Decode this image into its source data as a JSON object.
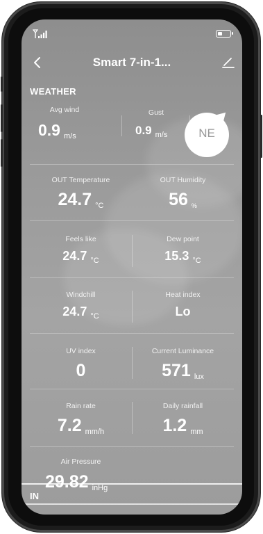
{
  "app": {
    "title": "Smart 7-in-1...",
    "section_weather": "WEATHER",
    "section_in": "IN"
  },
  "wind": {
    "avg_label": "Avg wind",
    "avg_value": "0.9",
    "avg_unit": "m/s",
    "gust_label": "Gust",
    "gust_value": "0.9",
    "gust_unit": "m/s",
    "direction": "NE"
  },
  "cells": {
    "out_temp_label": "OUT Temperature",
    "out_temp_value": "24.7",
    "out_temp_unit": "°C",
    "out_hum_label": "OUT Humidity",
    "out_hum_value": "56",
    "out_hum_unit": "%",
    "feels_label": "Feels like",
    "feels_value": "24.7",
    "feels_unit": "°C",
    "dew_label": "Dew point",
    "dew_value": "15.3",
    "dew_unit": "°C",
    "windchill_label": "Windchill",
    "windchill_value": "24.7",
    "windchill_unit": "°C",
    "heat_label": "Heat index",
    "heat_value": "Lo",
    "uv_label": "UV index",
    "uv_value": "0",
    "lum_label": "Current Luminance",
    "lum_value": "571",
    "lum_unit": "lux",
    "rain_rate_label": "Rain rate",
    "rain_rate_value": "7.2",
    "rain_rate_unit": "mm/h",
    "daily_rain_label": "Daily rainfall",
    "daily_rain_value": "1.2",
    "daily_rain_unit": "mm",
    "pressure_label": "Air Pressure",
    "pressure_value": "29.82",
    "pressure_unit": "inHg"
  },
  "colors": {
    "screen_bg": "#9a9a9a",
    "text": "#ffffff",
    "compass_bg": "#ffffff",
    "compass_text": "#999999"
  },
  "icons": {
    "signal": "signal-icon",
    "battery": "battery-icon",
    "back": "back-icon",
    "edit": "edit-icon"
  }
}
